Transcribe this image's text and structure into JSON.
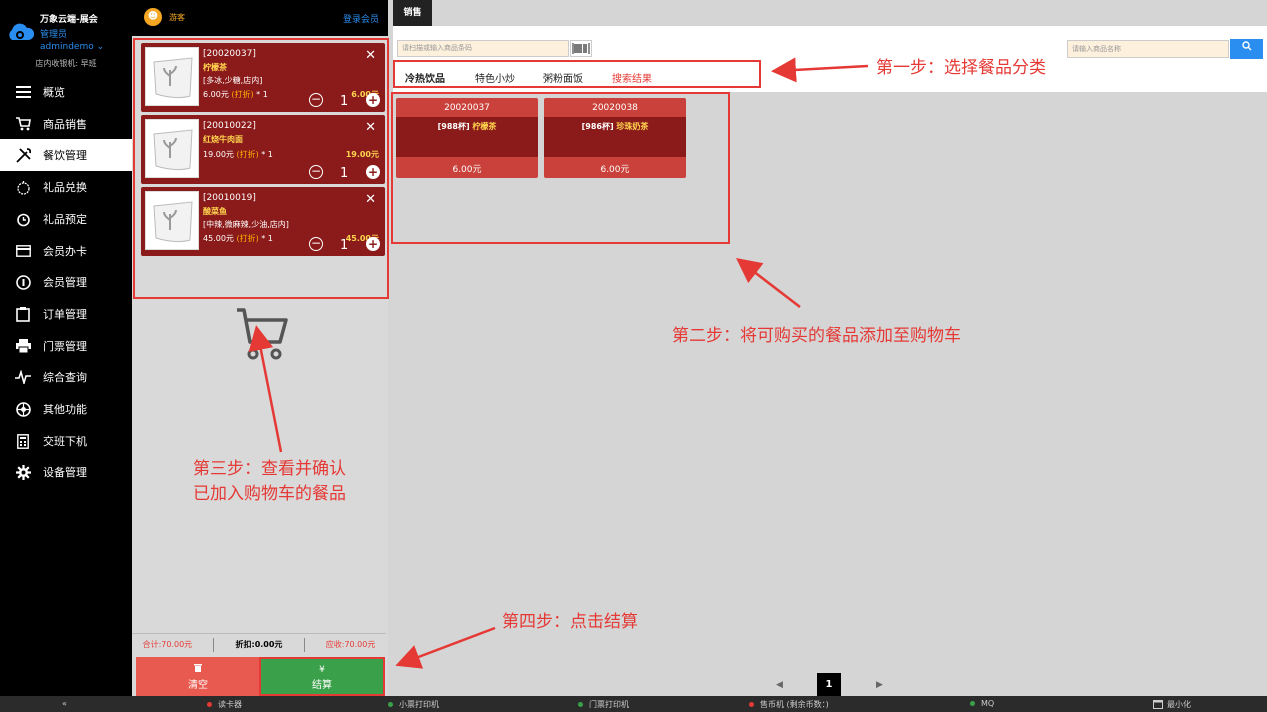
{
  "sidebar": {
    "org_name": "万象云端-展会",
    "role": "管理员",
    "user": "admindemo ⌄",
    "shift": "店内收银机: 早班",
    "items": [
      {
        "label": "概览",
        "icon": "menu-icon"
      },
      {
        "label": "商品销售",
        "icon": "cart-icon"
      },
      {
        "label": "餐饮管理",
        "icon": "utensils-icon"
      },
      {
        "label": "礼品兑换",
        "icon": "gift-icon"
      },
      {
        "label": "礼品预定",
        "icon": "alarm-icon"
      },
      {
        "label": "会员办卡",
        "icon": "card-icon"
      },
      {
        "label": "会员管理",
        "icon": "member-icon"
      },
      {
        "label": "订单管理",
        "icon": "clipboard-icon"
      },
      {
        "label": "门票管理",
        "icon": "printer-icon"
      },
      {
        "label": "综合查询",
        "icon": "pulse-icon"
      },
      {
        "label": "其他功能",
        "icon": "ball-icon"
      },
      {
        "label": "交班下机",
        "icon": "calculator-icon"
      },
      {
        "label": "设备管理",
        "icon": "gear-icon"
      }
    ],
    "active_index": 2,
    "collapse_label": "«"
  },
  "cart": {
    "guest_label": "游客",
    "login_label": "登录会员",
    "items": [
      {
        "code": "[20020037]",
        "name": "柠檬茶",
        "options": "[多冰,少糖,店内]",
        "unit_price": "6.00元",
        "discount": "(打折)",
        "times": "* 1",
        "subtotal": "6.00元",
        "qty": "1"
      },
      {
        "code": "[20010022]",
        "name": "红烧牛肉面",
        "options": "",
        "unit_price": "19.00元",
        "discount": "(打折)",
        "times": "* 1",
        "subtotal": "19.00元",
        "qty": "1"
      },
      {
        "code": "[20010019]",
        "name": "酸菜鱼",
        "options": "[中辣,微麻辣,少油,店内]",
        "unit_price": "45.00元",
        "discount": "(打折)",
        "times": "* 1",
        "subtotal": "45.00元",
        "qty": "1"
      }
    ],
    "summary": {
      "total": "合计:70.00元",
      "discount": "折扣:0.00元",
      "receivable": "应收:70.00元"
    },
    "clear_label": "清空",
    "clear_icon": "trash-icon",
    "pay_label": "结算",
    "pay_icon": "¥"
  },
  "main": {
    "tab_label": "销售",
    "scan_placeholder": "请扫描或输入商品条码",
    "name_placeholder": "请输入商品名称",
    "categories": [
      "冷热饮品",
      "特色小炒",
      "粥粉面饭",
      "搜索结果"
    ],
    "active_category": 0,
    "products": [
      {
        "code": "20020037",
        "stock": "[988杯]",
        "name": "柠檬茶",
        "price": "6.00元"
      },
      {
        "code": "20020038",
        "stock": "[986杯]",
        "name": "珍珠奶茶",
        "price": "6.00元"
      }
    ],
    "pager": {
      "prev": "◀",
      "current": "1",
      "next": "▶"
    }
  },
  "annotations": {
    "step1": "第一步：选择餐品分类",
    "step2": "第二步：将可购买的餐品添加至购物车",
    "step3_line1": "第三步：查看并确认",
    "step3_line2": "已加入购物车的餐品",
    "step4": "第四步：点击结算"
  },
  "statusbar": {
    "items": [
      {
        "label": "读卡器",
        "status": "red"
      },
      {
        "label": "小票打印机",
        "status": "green"
      },
      {
        "label": "门票打印机",
        "status": "green"
      },
      {
        "label": "售币机 (剩余币数：)",
        "status": "red"
      },
      {
        "label": "MQ",
        "status": "green"
      }
    ],
    "minimize_label": "最小化"
  },
  "colors": {
    "accent_red": "#e53935",
    "item_bg": "#8b1a1a",
    "product_bg": "#c9413a",
    "pay_green": "#3aa14a",
    "link_blue": "#2a8ef0"
  }
}
